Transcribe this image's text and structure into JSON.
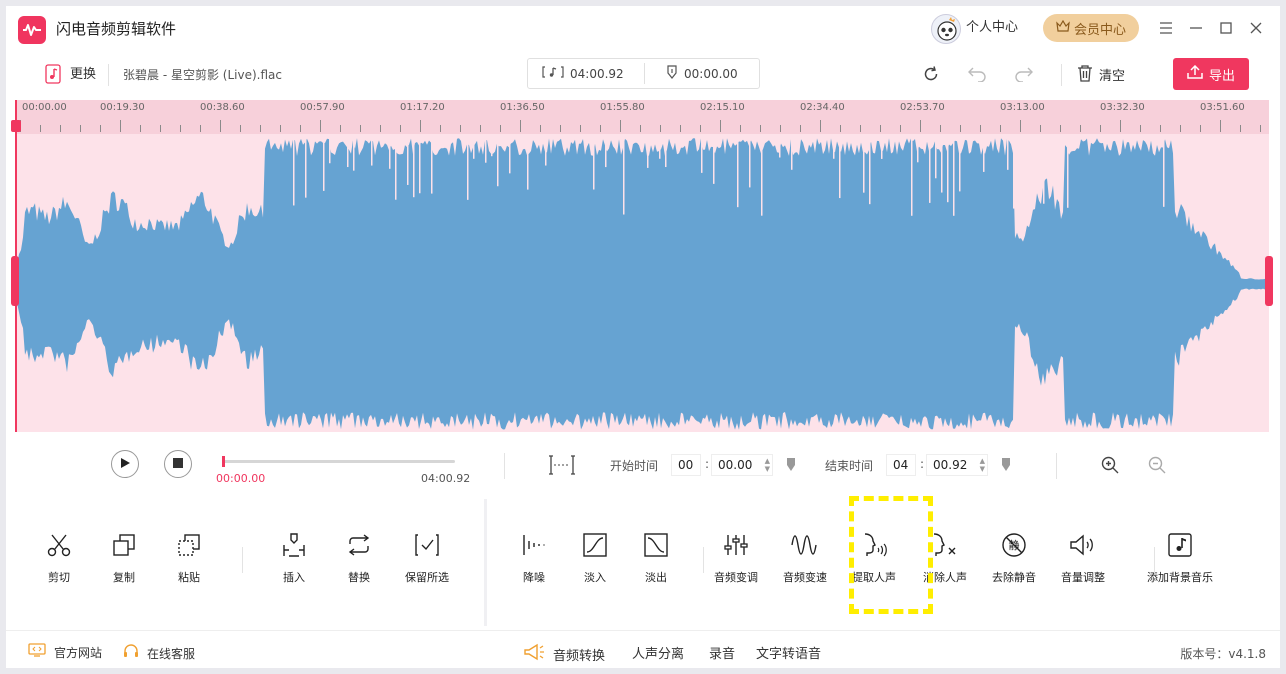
{
  "app": {
    "title": "闪电音频剪辑软件",
    "personal_center": "个人中心",
    "vip_center": "会员中心"
  },
  "toolbar": {
    "change_label": "更换",
    "file_name": "张碧晨 - 星空剪影 (Live).flac",
    "duration": "04:00.92",
    "selection_time": "00:00.00",
    "clear_label": "清空",
    "export_label": "导出"
  },
  "ruler": {
    "labels": [
      "00:00.00",
      "00:19.30",
      "00:38.60",
      "00:57.90",
      "01:17.20",
      "01:36.50",
      "01:55.80",
      "02:15.10",
      "02:34.40",
      "02:53.70",
      "03:13.00",
      "03:32.30",
      "03:51.60"
    ]
  },
  "transport": {
    "current_time": "00:00.00",
    "total_time": "04:00.92",
    "progress": 0.0,
    "start_label": "开始时间",
    "start_min": "00",
    "start_sec": "00.00",
    "end_label": "结束时间",
    "end_min": "04",
    "end_sec": "00.92",
    "colon": ":"
  },
  "tools_left": [
    {
      "label": "剪切",
      "icon": "scissors-icon"
    },
    {
      "label": "复制",
      "icon": "copy-icon"
    },
    {
      "label": "粘贴",
      "icon": "paste-icon"
    },
    {
      "label": "插入",
      "icon": "insert-icon"
    },
    {
      "label": "替换",
      "icon": "replace-icon"
    },
    {
      "label": "保留所选",
      "icon": "keep-selection-icon"
    }
  ],
  "tools_right": [
    {
      "label": "降噪",
      "icon": "denoise-icon"
    },
    {
      "label": "淡入",
      "icon": "fade-in-icon"
    },
    {
      "label": "淡出",
      "icon": "fade-out-icon"
    },
    {
      "label": "音频变调",
      "icon": "pitch-icon"
    },
    {
      "label": "音频变速",
      "icon": "speed-icon"
    },
    {
      "label": "提取人声",
      "icon": "extract-voice-icon"
    },
    {
      "label": "消除人声",
      "icon": "remove-voice-icon"
    },
    {
      "label": "去除静音",
      "icon": "remove-silence-icon"
    },
    {
      "label": "音量调整",
      "icon": "volume-icon"
    },
    {
      "label": "添加背景音乐",
      "icon": "bg-music-icon"
    }
  ],
  "remove_silence_glyph": "静",
  "footer": {
    "website": "官方网站",
    "support": "在线客服",
    "audio_convert": "音频转换",
    "vocal_separation": "人声分离",
    "record": "录音",
    "tts": "文字转语音",
    "version": "版本号：v4.1.8"
  },
  "colors": {
    "accent": "#f0375f",
    "wave": "#66a3d2",
    "wave_bg": "#fde2e9",
    "highlight": "#ffee00"
  }
}
